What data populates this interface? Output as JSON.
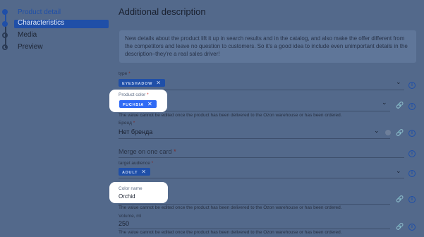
{
  "sidebar": {
    "steps": [
      {
        "label": "Product detail",
        "state": "done"
      },
      {
        "label": "Characteristics",
        "state": "active"
      },
      {
        "label": "Media",
        "state": "todo"
      },
      {
        "label": "Preview",
        "state": "todo"
      }
    ]
  },
  "main": {
    "title": "Additional description",
    "hint": "New details about the product lift it up in search results and in the catalog, and also make the offer different from the competitors and leave no question to customers. So it's a good idea to include even unimportant details in the description–they're a real sales driver!",
    "fields": {
      "type": {
        "label": "type",
        "tag": "EYESHADOW"
      },
      "product_color": {
        "label": "Product color",
        "tag": "FUCHSIA",
        "note": "The value cannot be edited once the product has been delivered to the Ozon warehouse or has been ordered."
      },
      "brand": {
        "label": "Бренд",
        "value": "Нет бренда"
      },
      "merge": {
        "placeholder": "Merge on one card"
      },
      "target_audience": {
        "label": "target audience",
        "tag": "ADULT"
      },
      "color_name": {
        "label": "Color name",
        "value": "Orchid",
        "note": "The value cannot be edited once the product has been delivered to the Ozon warehouse or has been ordered."
      },
      "volume": {
        "label": "Volume, ml",
        "value": "250",
        "note": "The value cannot be edited once the product has been delivered to the Ozon warehouse or has been ordered."
      }
    },
    "required_mark": "*",
    "remove_glyph": "✕"
  },
  "icons": {
    "info": "info-icon",
    "link": "link-icon",
    "chevron": "chevron-down-icon"
  },
  "colors": {
    "accent": "#2f6af5",
    "overlay": "#53698b",
    "required": "#d13b3b"
  }
}
